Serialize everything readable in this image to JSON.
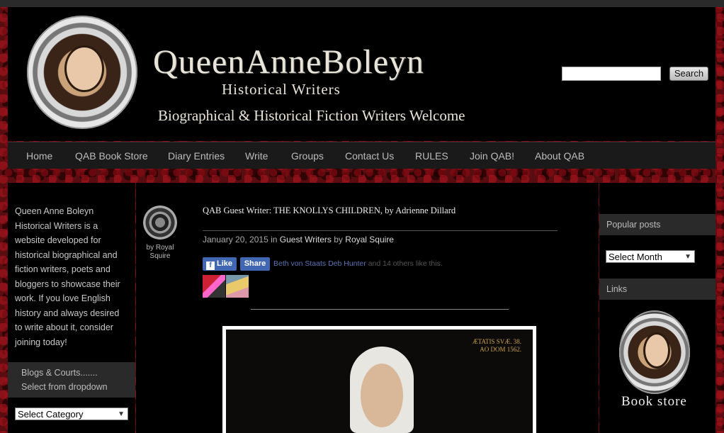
{
  "header": {
    "title": "QueenAnneBoleyn",
    "subtitle": "Historical Writers",
    "tagline": "Biographical & Historical Fiction Writers Welcome",
    "search_placeholder": "",
    "search_button": "Search"
  },
  "nav": {
    "items": [
      "Home",
      "QAB Book Store",
      "Diary Entries",
      "Write",
      "Groups",
      "Contact Us",
      "RULES",
      "Join QAB!",
      "About QAB"
    ]
  },
  "sidebar_left": {
    "intro": "Queen Anne Boleyn Historical Writers is a website developed for historical biographical and fiction writers, poets and bloggers to showcase their work. If you love English history and always desired to write about it, consider joining today!",
    "blogs_title": "Blogs & Courts.......",
    "blogs_sub": "Select from dropdown",
    "category_select": "Select Category"
  },
  "post": {
    "author_label": "by Royal Squire",
    "title": "QAB Guest Writer: THE KNOLLYS CHILDREN, by Adrienne Dillard",
    "date": "January 20, 2015",
    "in_word": "in",
    "category": "Guest Writers",
    "by_word": "by",
    "author": "Royal Squire",
    "fb_like": "Like",
    "fb_share": "Share",
    "fb_name1": "Beth von Staats",
    "fb_name2": "Deb Hunter",
    "fb_others": "and 14 others like this.",
    "image_inscription_1": "ÆTATIS SVÆ. 38.",
    "image_inscription_2": "AO DOM 1562."
  },
  "sidebar_right": {
    "popular_title": "Popular posts",
    "month_select": "Select Month",
    "links_title": "Links",
    "store_label": "Book store"
  }
}
